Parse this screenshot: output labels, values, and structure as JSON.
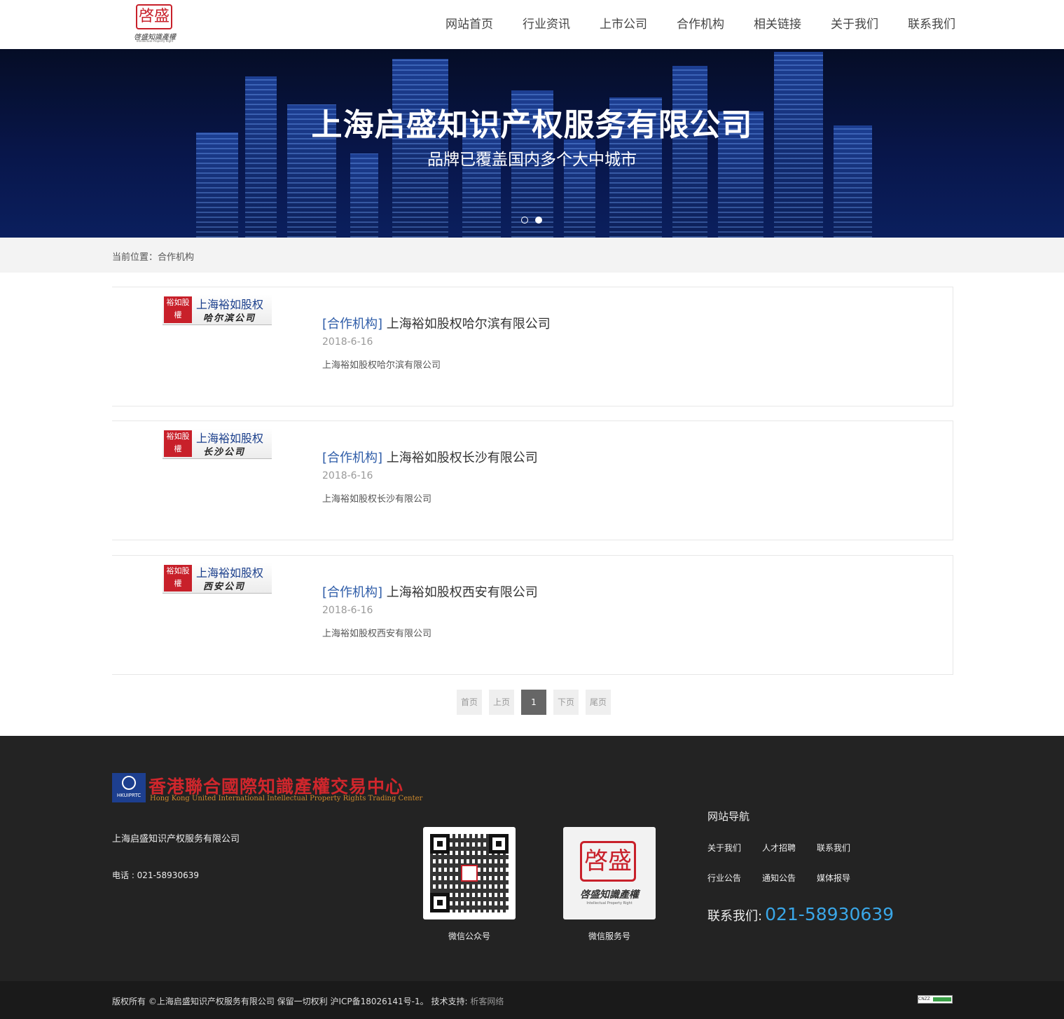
{
  "header": {
    "logo": {
      "seal": "啓盛",
      "cn": "啓盛知識產權",
      "en": "Intellectual Property Right"
    },
    "nav": [
      "网站首页",
      "行业资讯",
      "上市公司",
      "合作机构",
      "相关链接",
      "关于我们",
      "联系我们"
    ]
  },
  "banner": {
    "title": "上海启盛知识产权服务有限公司",
    "subtitle": "品牌已覆盖国内多个大中城市",
    "slides": 2,
    "active_slide": 2
  },
  "breadcrumb": {
    "label": "当前位置：",
    "current": "合作机构"
  },
  "articles": [
    {
      "category": "[合作机构]",
      "title": "上海裕如股权哈尔滨有限公司",
      "date": "2018-6-16",
      "desc": "上海裕如股权哈尔滨有限公司",
      "thumb": {
        "stamp": "裕如股權",
        "line1": "上海裕如股权",
        "line2": "哈尔滨公司"
      }
    },
    {
      "category": "[合作机构]",
      "title": "上海裕如股权长沙有限公司",
      "date": "2018-6-16",
      "desc": "上海裕如股权长沙有限公司",
      "thumb": {
        "stamp": "裕如股權",
        "line1": "上海裕如股权",
        "line2": "长沙公司"
      }
    },
    {
      "category": "[合作机构]",
      "title": "上海裕如股权西安有限公司",
      "date": "2018-6-16",
      "desc": "上海裕如股权西安有限公司",
      "thumb": {
        "stamp": "裕如股權",
        "line1": "上海裕如股权",
        "line2": "西安公司"
      }
    }
  ],
  "pager": {
    "first": "首页",
    "prev": "上页",
    "current": "1",
    "next": "下页",
    "last": "尾页"
  },
  "footer": {
    "logo": {
      "badge": "HKUIPRTC",
      "cn": "香港聯合國際知識產權交易中心",
      "en": "Hong Kong United International Intellectual Property Rights Trading Center"
    },
    "company": "上海启盛知识产权服务有限公司",
    "phone": "电话 : 021-58930639",
    "qr1_caption": "微信公众号",
    "qr2_caption": "微信服务号",
    "qr2": {
      "seal": "啓盛",
      "cn": "啓盛知識產權",
      "en": "Intellectual Property Right"
    },
    "nav_title": "网站导航",
    "nav": [
      "关于我们",
      "人才招聘",
      "联系我们",
      "行业公告",
      "通知公告",
      "媒体报导"
    ],
    "contact_label": "联系我们:",
    "contact_number": "021-58930639",
    "copyright": "版权所有 ©上海启盛知识产权服务有限公司 保留一切权利 沪ICP备18026141号-1。 技术支持: ",
    "support": "析客网络",
    "cnzz": "CNZZ"
  },
  "colors": {
    "accent_blue": "#2e5ca8",
    "phone_blue": "#3aa7e8",
    "seal_red": "#c8202a",
    "footer_bg": "#232323"
  }
}
